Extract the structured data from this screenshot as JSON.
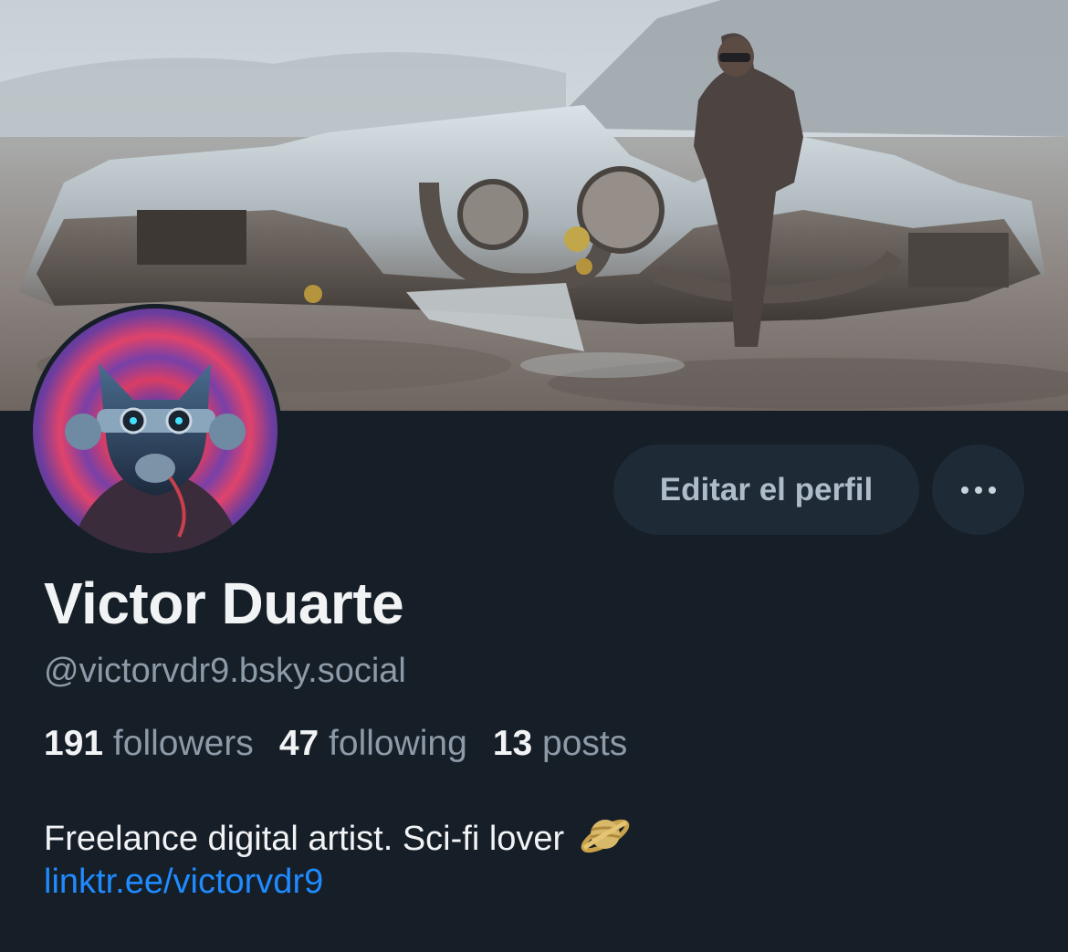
{
  "profile": {
    "display_name": "Victor Duarte",
    "handle": "@victorvdr9.bsky.social",
    "bio": "Freelance digital artist. Sci-fi lover",
    "bio_emoji": "ringed-planet-icon",
    "link": "linktr.ee/victorvdr9"
  },
  "stats": {
    "followers_count": "191",
    "followers_label": "followers",
    "following_count": "47",
    "following_label": "following",
    "posts_count": "13",
    "posts_label": "posts"
  },
  "actions": {
    "edit_profile_label": "Editar el perfil",
    "more_icon": "more-horizontal-icon"
  },
  "colors": {
    "background": "#161e27",
    "button_bg": "#1e2a36",
    "text_primary": "#f1f3f5",
    "text_secondary": "#8d9aa8",
    "link": "#1f8bff"
  }
}
